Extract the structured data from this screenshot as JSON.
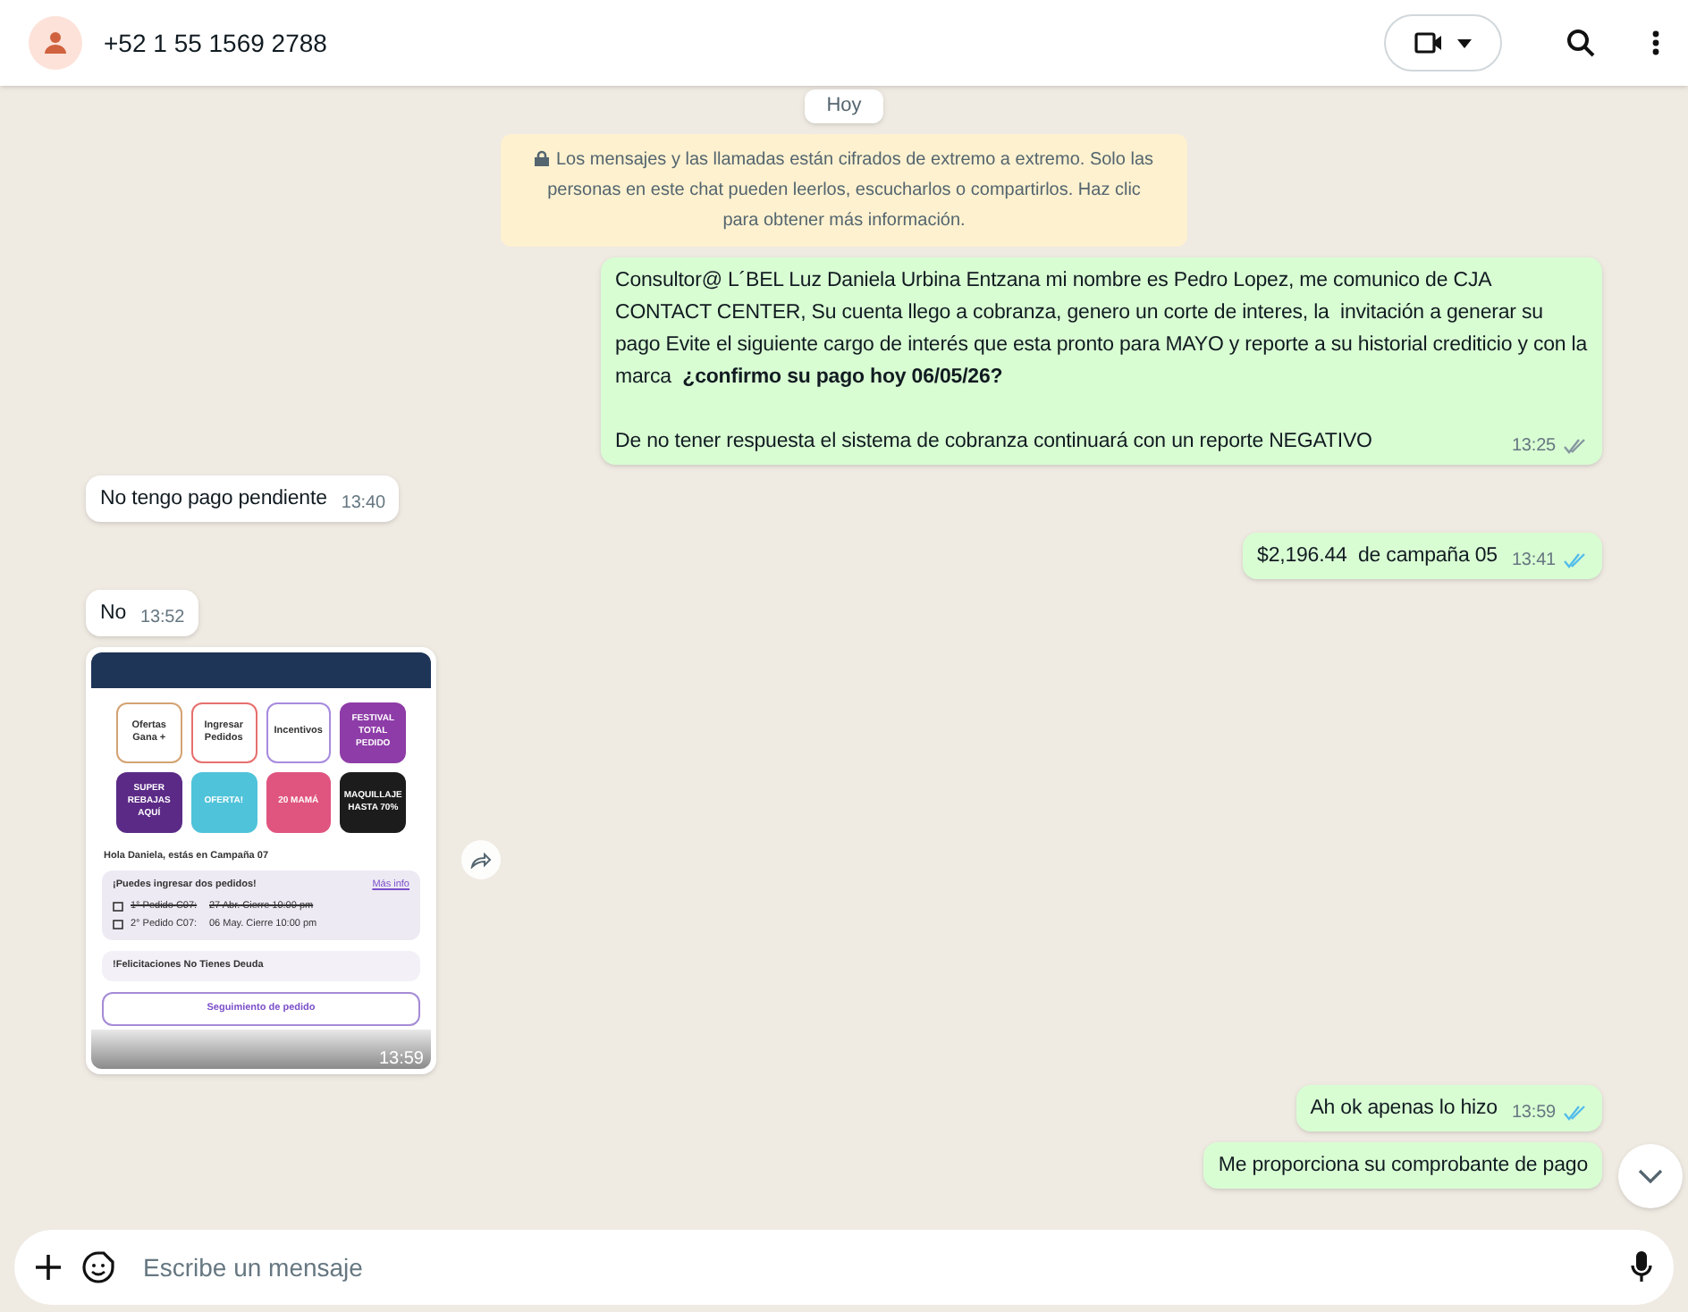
{
  "header": {
    "contact": "+52 1 55 1569 2788"
  },
  "date_chip": "Hoy",
  "notice": "Los mensajes y las llamadas están cifrados de extremo a extremo. Solo las personas en este chat pueden leerlos, escucharlos o compartirlos. Haz clic para obtener más información.",
  "messages": [
    {
      "kind": "text",
      "outgoing": true,
      "paragraphs": [
        "Consultor@ L´BEL Luz Daniela Urbina Entzana mi nombre es Pedro Lopez, me comunico de CJA CONTACT CENTER, Su cuenta llego a cobranza, genero un corte de interes, la  invitación a generar su pago Evite el siguiente cargo de interés que esta pronto para MAYO y reporte a su historial crediticio y con la marca  **¿confirmo su pago hoy 06/05/26?**",
        "De no tener respuesta el sistema de cobranza continuará con un reporte NEGATIVO"
      ],
      "time": "13:25",
      "read": false
    },
    {
      "kind": "text",
      "outgoing": false,
      "paragraphs": [
        "No tengo pago pendiente"
      ],
      "time": "13:40"
    },
    {
      "kind": "text",
      "outgoing": true,
      "paragraphs": [
        "$2,196.44  de campaña 05"
      ],
      "time": "13:41",
      "read": true
    },
    {
      "kind": "text",
      "outgoing": false,
      "paragraphs": [
        "No"
      ],
      "time": "13:52"
    },
    {
      "kind": "image",
      "outgoing": false,
      "time": "13:59",
      "screen": {
        "shortcuts": [
          {
            "label": "Ofertas Gana +",
            "color": "#d4a373"
          },
          {
            "label": "Ingresar Pedidos",
            "color": "#e76f6f"
          },
          {
            "label": "Incentivos",
            "color": "#a78bde"
          }
        ],
        "promos": [
          {
            "label": "FESTIVAL TOTAL PEDIDO",
            "color": "#8e3ca8"
          },
          {
            "label": "SUPER REBAJAS AQUÍ",
            "color": "#5b2a86"
          },
          {
            "label": "OFERTA!",
            "color": "#4fc3d9"
          },
          {
            "label": "20 MAMÁ",
            "color": "#e0557f"
          },
          {
            "label": "MAQUILLAJE HASTA 70%",
            "color": "#1c1c1c"
          }
        ],
        "greeting": "Hola Daniela, estás en Campaña 07",
        "orders_title": "¡Puedes ingresar dos pedidos!",
        "more_info": "Más info",
        "orders": [
          {
            "name": "1° Pedido C07:",
            "date": "27 Abr. Cierre 10:00 pm",
            "closed": true
          },
          {
            "name": "2° Pedido C07:",
            "date": "06 May. Cierre 10:00 pm",
            "closed": false
          }
        ],
        "debt_note": "!Felicitaciones No Tienes Deuda",
        "button": "Seguimiento de pedido"
      }
    },
    {
      "kind": "text",
      "outgoing": true,
      "paragraphs": [
        "Ah ok apenas lo hizo"
      ],
      "time": "13:59",
      "read": true
    },
    {
      "kind": "text",
      "outgoing": true,
      "paragraphs": [
        "Me proporciona su comprobante de pago"
      ]
    }
  ],
  "composer": {
    "placeholder": "Escribe un mensaje"
  }
}
